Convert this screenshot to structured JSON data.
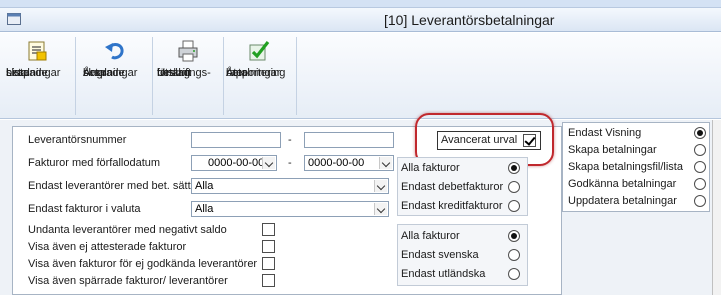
{
  "window": {
    "title": "[10]  Leverantörsbetalningar"
  },
  "toolbar": {
    "buttons": [
      {
        "lines": [
          "Lista",
          "skapade",
          "betalningar"
        ],
        "icon": "list-document-icon"
      },
      {
        "lines": [
          "Ångra",
          "skapade",
          "betalningar"
        ],
        "icon": "undo-arrow-icon"
      },
      {
        "lines": [
          "Utskrift",
          "betalnings-",
          "förslag"
        ],
        "icon": "printer-icon"
      },
      {
        "lines": [
          "Åter-",
          "rapportering",
          "betalningar"
        ],
        "icon": "green-check-icon",
        "disabled": true
      }
    ]
  },
  "filters": {
    "supplier_number": {
      "label": "Leverantörsnummer",
      "from": "",
      "to": "",
      "separator": "-"
    },
    "due_date": {
      "label": "Fakturor med förfallodatum",
      "from": "0000-00-00",
      "to": "0000-00-00",
      "separator": "-"
    },
    "payment_method": {
      "label": "Endast leverantörer med bet. sätt",
      "value": "Alla"
    },
    "currency": {
      "label": "Endast fakturor i valuta",
      "value": "Alla"
    },
    "checkboxes": [
      {
        "label": "Undanta leverantörer med negativt saldo",
        "checked": false
      },
      {
        "label": "Visa även ej attesterade fakturor",
        "checked": false
      },
      {
        "label": "Visa även fakturor för ej godkända leverantörer",
        "checked": false
      },
      {
        "label": "Visa även spärrade fakturor/ leverantörer",
        "checked": false
      }
    ]
  },
  "advanced": {
    "label": "Avancerat urval",
    "checked": true
  },
  "invoice_type": {
    "options": [
      {
        "label": "Alla fakturor",
        "selected": true
      },
      {
        "label": "Endast debetfakturor",
        "selected": false
      },
      {
        "label": "Endast kreditfakturor",
        "selected": false
      }
    ]
  },
  "origin": {
    "options": [
      {
        "label": "Alla fakturor",
        "selected": true
      },
      {
        "label": "Endast svenska",
        "selected": false
      },
      {
        "label": "Endast utländska",
        "selected": false
      }
    ]
  },
  "mode": {
    "options": [
      {
        "label": "Endast Visning",
        "selected": true
      },
      {
        "label": "Skapa betalningar",
        "selected": false
      },
      {
        "label": "Skapa betalningsfil/lista",
        "selected": false
      },
      {
        "label": "Godkänna betalningar",
        "selected": false
      },
      {
        "label": "Uppdatera betalningar",
        "selected": false
      }
    ]
  },
  "colors": {
    "highlight": "#c0282d",
    "panel_border": "#a7b4c4",
    "ribbon_bg": "#e6edf6"
  }
}
